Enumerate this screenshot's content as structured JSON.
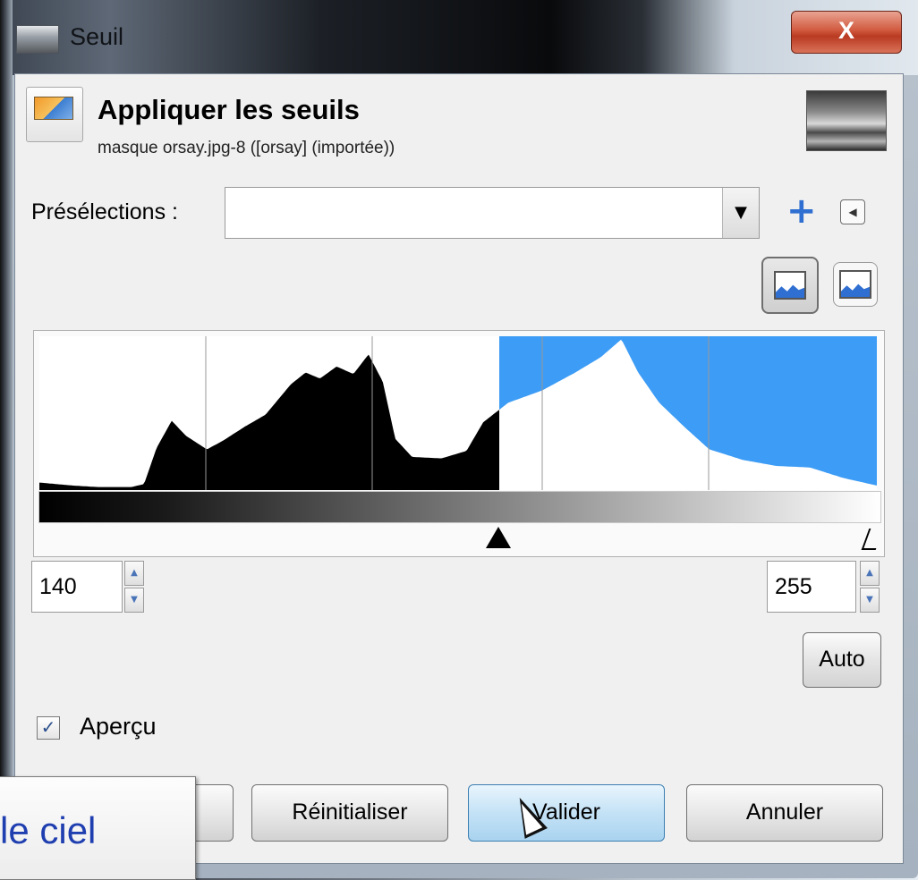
{
  "window": {
    "title": "Seuil",
    "close_label": "X"
  },
  "header": {
    "title": "Appliquer les seuils",
    "subtitle": "masque orsay.jpg-8 ([orsay] (importée))"
  },
  "presets": {
    "label": "Présélections :",
    "value": "",
    "add_icon": "plus-icon",
    "menu_icon": "triangle-left-icon"
  },
  "histogram": {
    "low_value": "140",
    "high_value": "255",
    "low_threshold": 140,
    "high_threshold": 255,
    "colors": {
      "selected": "#3d9cf5",
      "histogram_fill": "#000000",
      "background": "#ffffff"
    }
  },
  "auto_label": "Auto",
  "preview": {
    "label": "Aperçu",
    "checked": true
  },
  "buttons": {
    "reset": "Réinitialiser",
    "ok": "Valider",
    "cancel": "Annuler"
  },
  "tooltip": {
    "text": "le ciel"
  }
}
